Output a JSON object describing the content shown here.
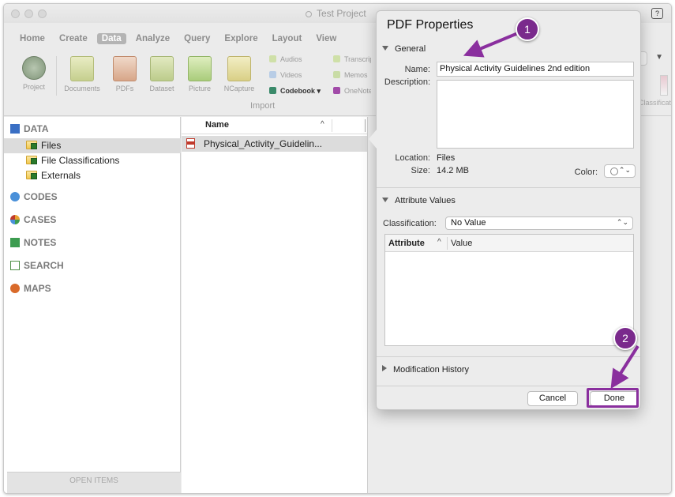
{
  "window": {
    "title": "Test Project",
    "help_icon": "help-icon"
  },
  "ribbon": {
    "tabs": [
      {
        "label": "Home",
        "active": false
      },
      {
        "label": "Create",
        "active": false
      },
      {
        "label": "Data",
        "active": true
      },
      {
        "label": "Analyze",
        "active": false
      },
      {
        "label": "Query",
        "active": false
      },
      {
        "label": "Explore",
        "active": false
      },
      {
        "label": "Layout",
        "active": false
      },
      {
        "label": "View",
        "active": false
      }
    ],
    "tools": {
      "project": "Project",
      "documents": "Documents",
      "pdfs": "PDFs",
      "dataset": "Dataset",
      "picture": "Picture",
      "ncapture": "NCapture"
    },
    "small_tools": {
      "audios": "Audios",
      "videos": "Videos",
      "codebook": "Codebook ▾",
      "transcripts": "Transcripts",
      "memos": "Memos",
      "onenote": "OneNote"
    },
    "group_label": "Import",
    "right_label": "Classificat"
  },
  "nav": {
    "data_section": "DATA",
    "items": [
      {
        "label": "Files",
        "selected": true
      },
      {
        "label": "File Classifications",
        "selected": false
      },
      {
        "label": "Externals",
        "selected": false
      }
    ],
    "sections": [
      "CODES",
      "CASES",
      "NOTES",
      "SEARCH",
      "MAPS"
    ],
    "open_items": "OPEN ITEMS",
    "colors": {
      "codes": "#4a90d9",
      "cases": "#e8a030",
      "notes": "#3c9c50",
      "search": "#4e8f45",
      "maps": "#d96a2a",
      "data": "#3a6fc4"
    }
  },
  "list": {
    "column_name": "Name",
    "sort_indicator": "^",
    "rows": [
      {
        "name": "Physical_Activity_Guidelin..."
      }
    ]
  },
  "popover": {
    "title": "PDF Properties",
    "general": {
      "section_label": "General",
      "name_label": "Name:",
      "name_value": "Physical Activity Guidelines 2nd edition",
      "description_label": "Description:",
      "description_value": "",
      "location_label": "Location:",
      "location_value": "Files",
      "size_label": "Size:",
      "size_value": "14.2 MB",
      "color_label": "Color:",
      "updown_glyph": "⌃⌄"
    },
    "attributes": {
      "section_label": "Attribute Values",
      "classification_label": "Classification:",
      "classification_value": "No Value",
      "col_attribute": "Attribute",
      "col_sort": "^",
      "col_value": "Value"
    },
    "history_label": "Modification History",
    "cancel_label": "Cancel",
    "done_label": "Done"
  },
  "annotations": {
    "badge_1": "1",
    "badge_2": "2",
    "color": "#8a2f9e"
  }
}
